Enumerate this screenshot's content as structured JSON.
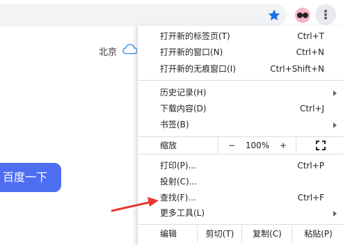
{
  "toolbar": {
    "star_icon": "star-icon",
    "avatar_icon": "sunglasses-avatar",
    "menu_icon": "kebab-menu-icon",
    "accent": "#1a73e8"
  },
  "page": {
    "city": "北京",
    "search_button": "百度一下",
    "button_color": "#4e6ef2"
  },
  "menu": {
    "new_tab": {
      "label": "打开新的标签页(T)",
      "shortcut": "Ctrl+T"
    },
    "new_window": {
      "label": "打开新的窗口(N)",
      "shortcut": "Ctrl+N"
    },
    "incognito": {
      "label": "打开新的无痕窗口(I)",
      "shortcut": "Ctrl+Shift+N"
    },
    "history": {
      "label": "历史记录(H)"
    },
    "downloads": {
      "label": "下载内容(D)",
      "shortcut": "Ctrl+J"
    },
    "bookmarks": {
      "label": "书签(B)"
    },
    "zoom": {
      "label": "缩放",
      "minus": "−",
      "value": "100%",
      "plus": "+"
    },
    "print": {
      "label": "打印(P)...",
      "shortcut": "Ctrl+P"
    },
    "cast": {
      "label": "投射(C)..."
    },
    "find": {
      "label": "查找(F)...",
      "shortcut": "Ctrl+F"
    },
    "more_tools": {
      "label": "更多工具(L)"
    },
    "edit": {
      "label": "编辑",
      "cut": "剪切(T)",
      "copy": "复制(C)",
      "paste": "粘贴(P)"
    }
  }
}
